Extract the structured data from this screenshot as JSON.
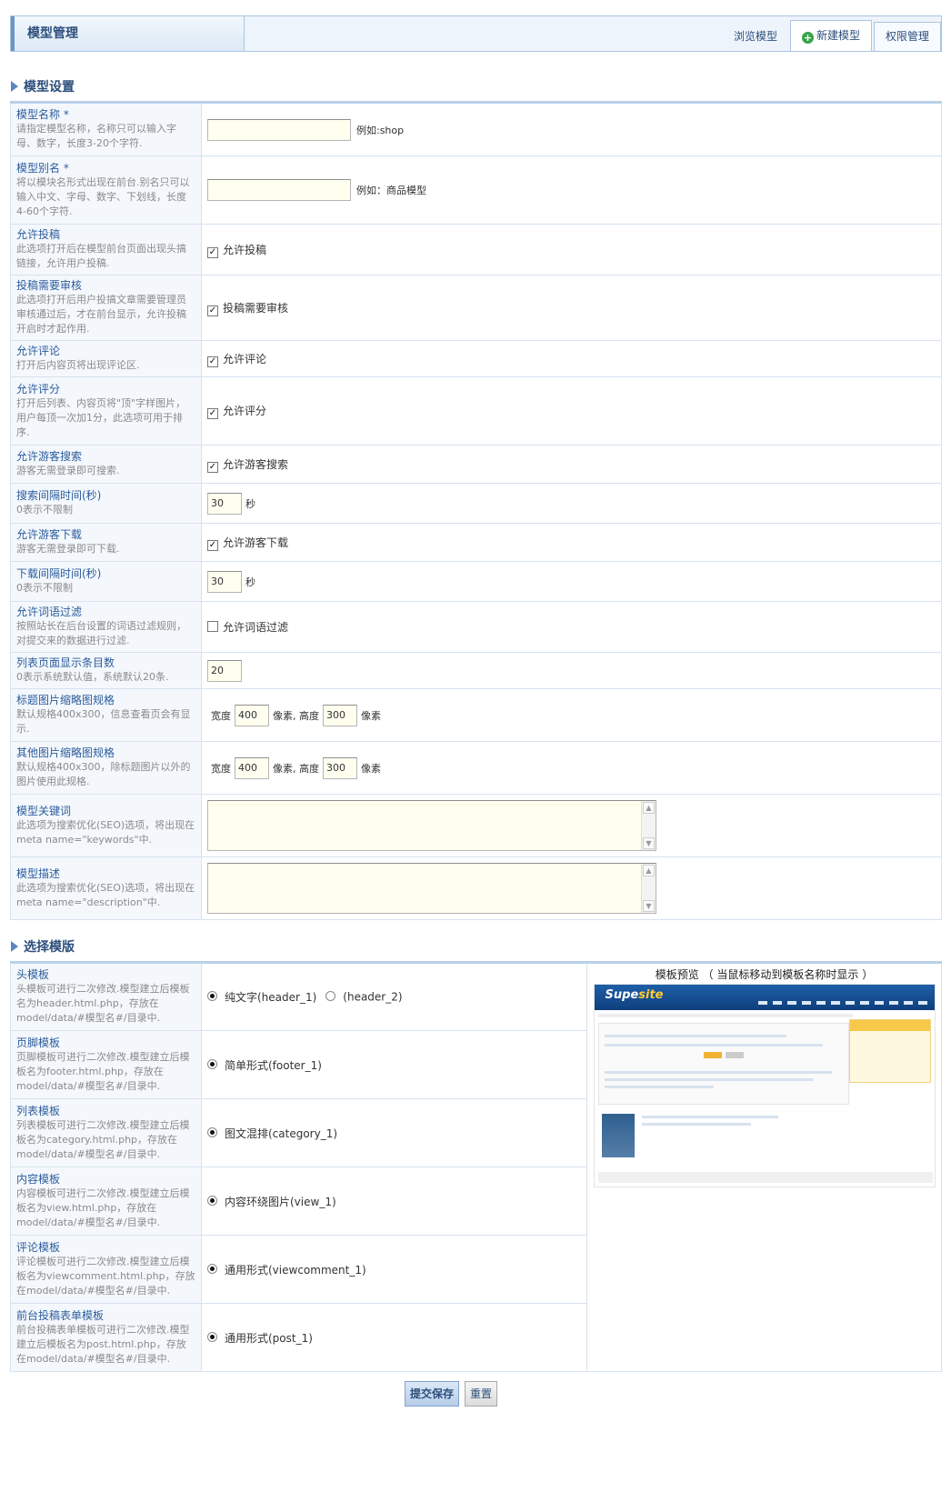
{
  "header": {
    "title": "模型管理",
    "tabs": [
      {
        "label": "浏览模型"
      },
      {
        "label": "新建模型"
      },
      {
        "label": "权限管理"
      }
    ]
  },
  "settings": {
    "heading": "模型设置",
    "name": {
      "label": "模型名称 *",
      "desc": "请指定模型名称，名称只可以输入字母、数字，长度3-20个字符.",
      "value": "",
      "hint": "例如:shop"
    },
    "alias": {
      "label": "模型别名 *",
      "desc": "将以模块名形式出现在前台.别名只可以输入中文、字母、数字、下划线，长度4-60个字符.",
      "value": "",
      "hint": "例如：商品模型"
    },
    "allow_post": {
      "label": "允许投稿",
      "desc": "此选项打开后在模型前台页面出现头搞链接，允许用户投稿.",
      "check_label": "允许投稿",
      "checked": true
    },
    "post_review": {
      "label": "投稿需要审核",
      "desc": "此选项打开后用户投搞文章需要管理员审核通过后，才在前台显示，允许投稿开启时才起作用.",
      "check_label": "投稿需要审核",
      "checked": true
    },
    "allow_comment": {
      "label": "允许评论",
      "desc": "打开后内容页将出现评论区.",
      "check_label": "允许评论",
      "checked": true
    },
    "allow_rate": {
      "label": "允许评分",
      "desc": "打开后列表、内容页将\"顶\"字样图片，用户每顶一次加1分，此选项可用于排序.",
      "check_label": "允许评分",
      "checked": true
    },
    "guest_search": {
      "label": "允许游客搜索",
      "desc": "游客无需登录即可搜索.",
      "check_label": "允许游客搜索",
      "checked": true
    },
    "search_interval": {
      "label": "搜索间隔时间(秒)",
      "desc": "0表示不限制",
      "value": "30",
      "unit": "秒"
    },
    "guest_download": {
      "label": "允许游客下载",
      "desc": "游客无需登录即可下载.",
      "check_label": "允许游客下载",
      "checked": true
    },
    "download_interval": {
      "label": "下载间隔时间(秒)",
      "desc": "0表示不限制",
      "value": "30",
      "unit": "秒"
    },
    "word_filter": {
      "label": "允许词语过滤",
      "desc": "按照站长在后台设置的词语过滤规则，对提交来的数据进行过滤.",
      "check_label": "允许词语过滤",
      "checked": false
    },
    "list_count": {
      "label": "列表页面显示条目数",
      "desc": "0表示系统默认值，系统默认20条.",
      "value": "20"
    },
    "title_thumb": {
      "label": "标题图片缩略图规格",
      "desc": "默认规格400x300，信息查看页会有显示.",
      "w_label": "宽度",
      "w": "400",
      "mid": "像素, 高度",
      "h": "300",
      "unit": "像素"
    },
    "other_thumb": {
      "label": "其他图片缩略图规格",
      "desc": "默认规格400x300，除标题图片以外的图片使用此规格.",
      "w_label": "宽度",
      "w": "400",
      "mid": "像素, 高度",
      "h": "300",
      "unit": "像素"
    },
    "keywords": {
      "label": "模型关键词",
      "desc": "此选项为搜索优化(SEO)选项，将出现在meta name=\"keywords\"中.",
      "value": ""
    },
    "description": {
      "label": "模型描述",
      "desc": "此选项为搜索优化(SEO)选项，将出现在meta name=\"description\"中.",
      "value": ""
    }
  },
  "templates": {
    "heading": "选择模版",
    "preview_title": "模板预览 （ 当鼠标移动到模板名称时显示 ）",
    "header_tpl": {
      "label": "头模板",
      "desc": "头模板可进行二次修改.模型建立后模板名为header.html.php，存放在model/data/#模型名#/目录中.",
      "opt1": "纯文字(header_1)",
      "opt2": "(header_2)"
    },
    "footer_tpl": {
      "label": "页脚模板",
      "desc": "页脚模板可进行二次修改.模型建立后模板名为footer.html.php，存放在model/data/#模型名#/目录中.",
      "opt1": "简单形式(footer_1)"
    },
    "category_tpl": {
      "label": "列表模板",
      "desc": "列表模板可进行二次修改.模型建立后模板名为category.html.php，存放在model/data/#模型名#/目录中.",
      "opt1": "图文混排(category_1)"
    },
    "view_tpl": {
      "label": "内容模板",
      "desc": "内容模板可进行二次修改.模型建立后模板名为view.html.php，存放在model/data/#模型名#/目录中.",
      "opt1": "内容环绕图片(view_1)"
    },
    "comment_tpl": {
      "label": "评论模板",
      "desc": "评论模板可进行二次修改.模型建立后模板名为viewcomment.html.php，存放在model/data/#模型名#/目录中.",
      "opt1": "通用形式(viewcomment_1)"
    },
    "post_tpl": {
      "label": "前台投稿表单模板",
      "desc": "前台投稿表单模板可进行二次修改.模型建立后模板名为post.html.php，存放在model/data/#模型名#/目录中.",
      "opt1": "通用形式(post_1)"
    }
  },
  "actions": {
    "submit": "提交保存",
    "reset": "重置"
  }
}
